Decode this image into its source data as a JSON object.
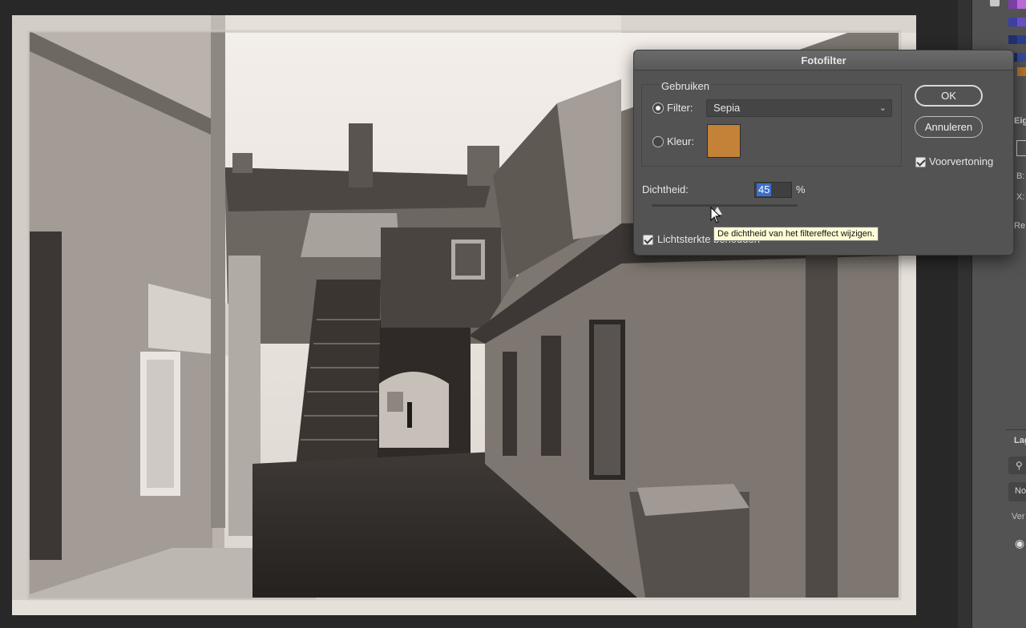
{
  "dialog": {
    "title": "Fotofilter",
    "group_label": "Gebruiken",
    "filter_label": "Filter:",
    "filter_value": "Sepia",
    "color_label": "Kleur:",
    "color_hex": "#c48238",
    "density_label": "Dichtheid:",
    "density_value": "45",
    "density_unit": "%",
    "density_level": 0.45,
    "preserve_luminosity_label": "Lichtsterkte behouden",
    "ok_label": "OK",
    "cancel_label": "Annuleren",
    "preview_label": "Voorvertoning",
    "tooltip": "De dichtheid van het filtereffect wijzigen."
  },
  "panels": {
    "properties_tab_partial": "Eig",
    "field_b_partial": "B:",
    "field_x_partial": "X:",
    "reset_partial": "Re",
    "layers_tab_partial": "Lag",
    "normal_partial": "No",
    "lock_partial": "Ver"
  },
  "icons": {
    "chevron": "chevron-down-icon",
    "visibility": "eye-icon",
    "search": "search-icon",
    "cursor": "mouse-pointer-icon"
  },
  "colors": {
    "dialog_bg": "#535353",
    "selection_blue": "#3b6fcd",
    "tooltip_bg": "#fffdd6",
    "sepia_swatch": "#c48238"
  }
}
